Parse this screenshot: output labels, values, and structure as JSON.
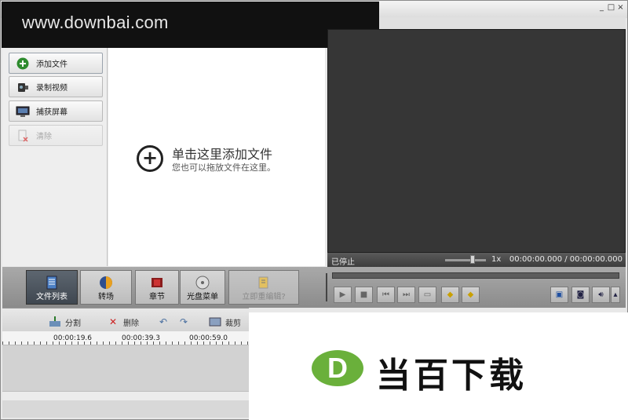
{
  "window": {
    "minimize": "_",
    "maximize": "□",
    "close": "×"
  },
  "watermark": {
    "text": "www.downbai.com"
  },
  "sidebar": {
    "items": [
      {
        "label": "添加文件",
        "icon": "plus-circle-icon",
        "enabled": true
      },
      {
        "label": "录制视频",
        "icon": "camcorder-icon",
        "enabled": true
      },
      {
        "label": "捕获屏幕",
        "icon": "monitor-icon",
        "enabled": true
      },
      {
        "label": "清除",
        "icon": "clear-file-icon",
        "enabled": false
      }
    ]
  },
  "droparea": {
    "main": "单击这里添加文件",
    "sub": "您也可以拖放文件在这里。"
  },
  "preview": {
    "status": "已停止",
    "speed": "1x",
    "time": "00:00:00.000 / 00:00:00.000"
  },
  "toolbar": {
    "items": [
      {
        "label": "文件列表",
        "icon": "file-list-icon",
        "active": true
      },
      {
        "label": "转场",
        "icon": "transition-icon"
      },
      {
        "label": "章节",
        "icon": "chapter-icon"
      },
      {
        "label": "光盘菜单",
        "icon": "disc-menu-icon"
      },
      {
        "label": "立即重编辑?",
        "icon": "re-edit-icon",
        "disabled": true
      }
    ]
  },
  "player": {
    "buttons": [
      "play-icon",
      "stop-icon",
      "prev-icon",
      "next-icon",
      "clip-icon",
      "mark-in-icon",
      "mark-out-icon",
      "fit-icon",
      "snapshot-icon",
      "volume-icon",
      "chevron-up-icon"
    ]
  },
  "timeline": {
    "split": "分割",
    "delete": "删除",
    "crop": "裁剪",
    "ticks": [
      "00:00:19.6",
      "00:00:39.3",
      "00:00:59.0"
    ]
  },
  "logo": {
    "letter": "D",
    "text": "当百下载",
    "color": "#6ab03b"
  }
}
